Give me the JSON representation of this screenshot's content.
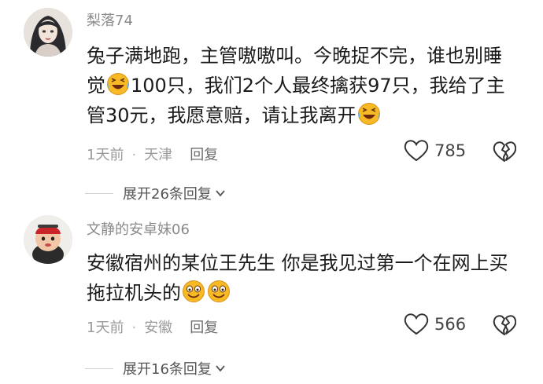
{
  "comments": [
    {
      "username": "梨落74",
      "text_1": "兔子满地跑，主管嗷嗷叫。今晚捉不完，谁也别睡觉",
      "text_2": "100只，我们2个人最终擒获97只，我给了主管30元，我愿意赔，请让我离开",
      "emoji": "laughing-tears-emoji",
      "time": "1天前",
      "location": "天津",
      "reply_label": "回复",
      "likes": "785",
      "expand_label": "展开26条回复"
    },
    {
      "username": "文静的安卓妹06",
      "text_1": "安徽宿州的某位王先生 你是我见过第一个在网上买拖拉机头的",
      "emoji": "grin-emoji",
      "time": "1天前",
      "location": "安徽",
      "reply_label": "回复",
      "likes": "566",
      "expand_label": "展开16条回复"
    }
  ],
  "icons": {
    "like": "heart-outline-icon",
    "dislike": "broken-heart-icon",
    "expand": "chevron-down-icon"
  },
  "colors": {
    "username": "#8a8a8a",
    "meta": "#9a9a9a",
    "emoji": "#f7b924"
  }
}
